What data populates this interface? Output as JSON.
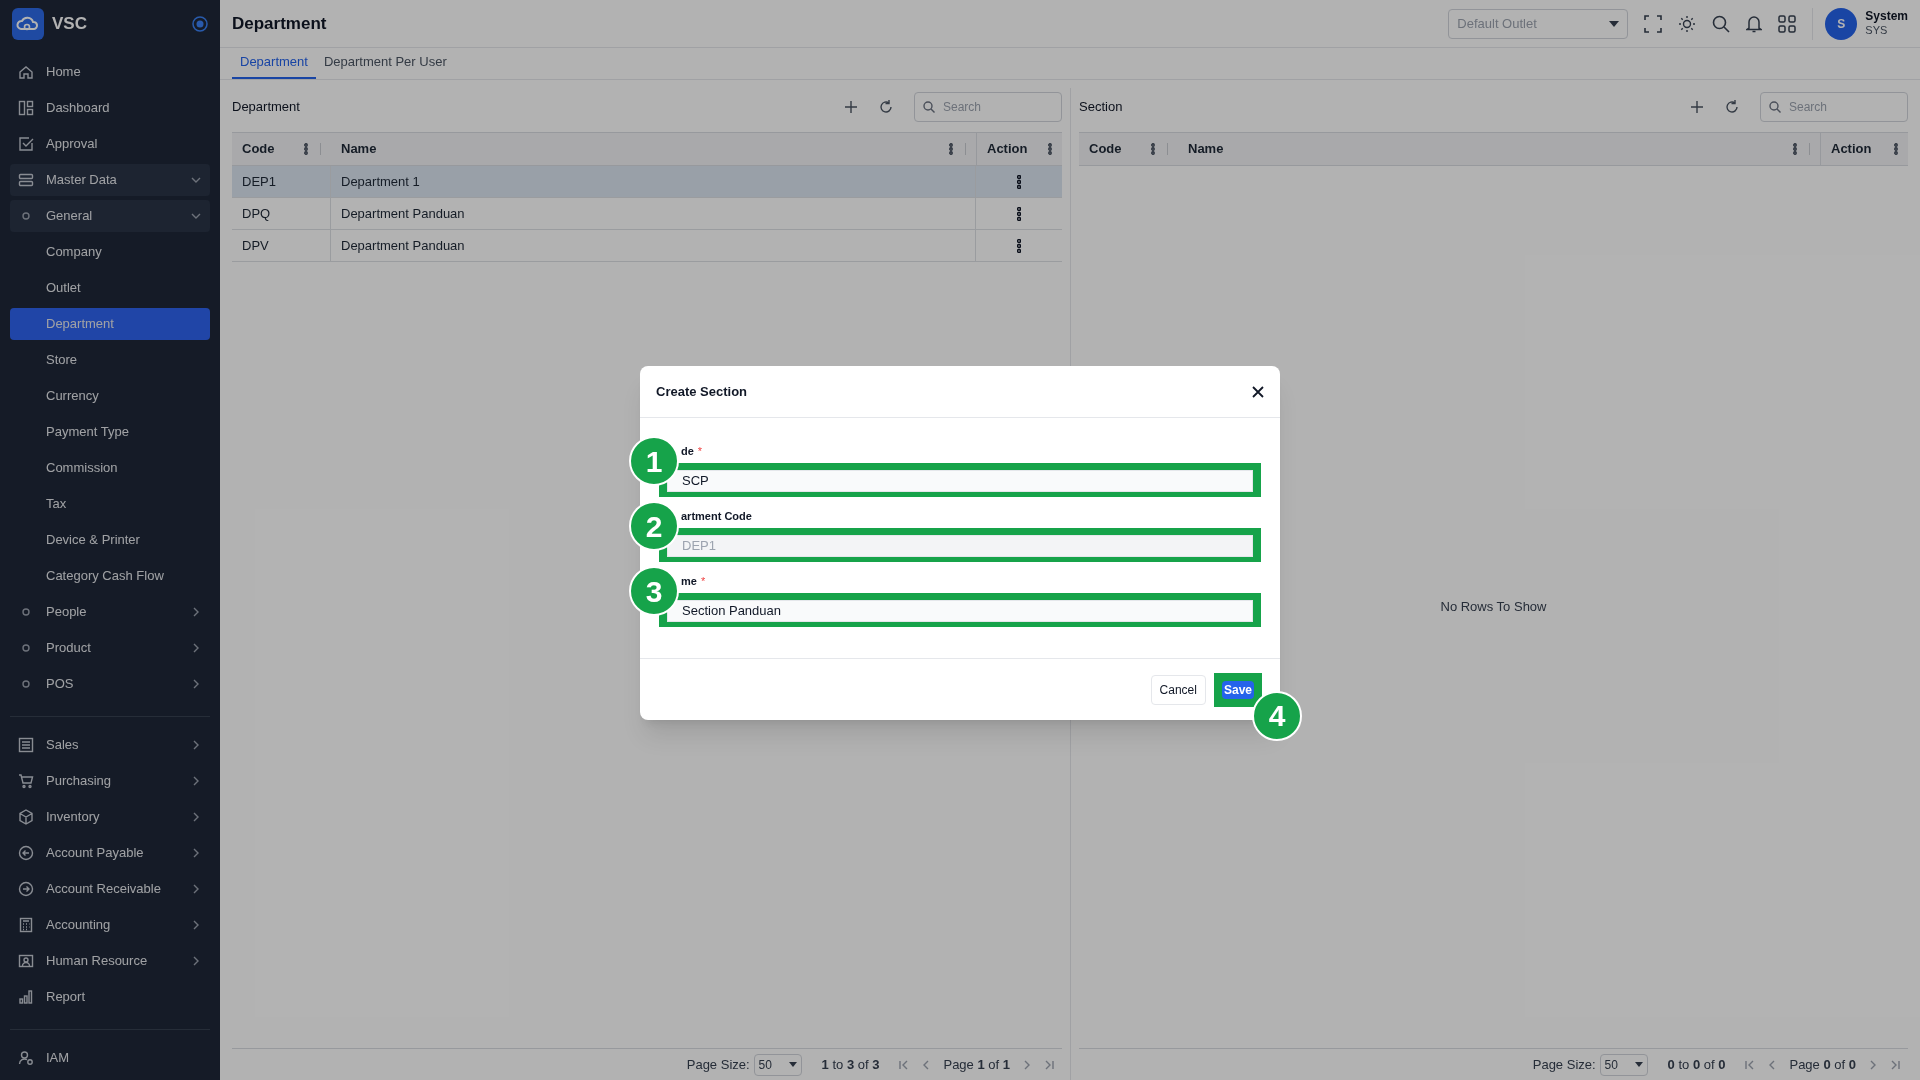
{
  "app": {
    "name": "VSC"
  },
  "sidebar": {
    "groups": [
      [
        {
          "label": "Home",
          "kind": "link",
          "selected": false
        },
        {
          "label": "Dashboard",
          "kind": "link",
          "selected": false
        },
        {
          "label": "Approval",
          "kind": "link",
          "selected": false
        },
        {
          "label": "Master Data",
          "kind": "menu",
          "selected": false,
          "expanded": true,
          "children": [
            {
              "label": "General",
              "kind": "menu",
              "selected": false,
              "expanded": true,
              "children": [
                {
                  "label": "Company",
                  "kind": "link",
                  "selected": false
                },
                {
                  "label": "Outlet",
                  "kind": "link",
                  "selected": false
                },
                {
                  "label": "Department",
                  "kind": "link",
                  "selected": true
                },
                {
                  "label": "Store",
                  "kind": "link",
                  "selected": false
                },
                {
                  "label": "Currency",
                  "kind": "link",
                  "selected": false
                },
                {
                  "label": "Payment Type",
                  "kind": "link",
                  "selected": false
                },
                {
                  "label": "Commission",
                  "kind": "link",
                  "selected": false
                },
                {
                  "label": "Tax",
                  "kind": "link",
                  "selected": false
                },
                {
                  "label": "Device & Printer",
                  "kind": "link",
                  "selected": false
                },
                {
                  "label": "Category Cash Flow",
                  "kind": "link",
                  "selected": false
                }
              ]
            },
            {
              "label": "People",
              "kind": "menu",
              "selected": false,
              "expanded": false
            },
            {
              "label": "Product",
              "kind": "menu",
              "selected": false,
              "expanded": false
            },
            {
              "label": "POS",
              "kind": "menu",
              "selected": false,
              "expanded": false
            }
          ]
        }
      ],
      [
        {
          "label": "Sales",
          "kind": "menu",
          "selected": false,
          "expanded": false
        },
        {
          "label": "Purchasing",
          "kind": "menu",
          "selected": false,
          "expanded": false
        },
        {
          "label": "Inventory",
          "kind": "menu",
          "selected": false,
          "expanded": false
        },
        {
          "label": "Account Payable",
          "kind": "menu",
          "selected": false,
          "expanded": false
        },
        {
          "label": "Account Receivable",
          "kind": "menu",
          "selected": false,
          "expanded": false
        },
        {
          "label": "Accounting",
          "kind": "menu",
          "selected": false,
          "expanded": false
        },
        {
          "label": "Human Resource",
          "kind": "menu",
          "selected": false,
          "expanded": false
        },
        {
          "label": "Report",
          "kind": "link",
          "selected": false
        }
      ],
      [
        {
          "label": "IAM",
          "kind": "link",
          "selected": false
        }
      ]
    ]
  },
  "header": {
    "title": "Department",
    "outlet_select": {
      "placeholder": "Default Outlet"
    },
    "user": {
      "initial": "S",
      "name": "System",
      "code": "SYS"
    }
  },
  "tabs": [
    {
      "label": "Department",
      "selected": true
    },
    {
      "label": "Department Per User",
      "selected": false
    }
  ],
  "panels": [
    {
      "title": "Department",
      "search": {
        "placeholder": "Search"
      },
      "table": {
        "columns": [
          "Code",
          "Name",
          "Action"
        ],
        "rows": [
          {
            "code": "DEP1",
            "name": "Department 1",
            "selected": true
          },
          {
            "code": "DPQ",
            "name": "Department Panduan",
            "selected": false
          },
          {
            "code": "DPV",
            "name": "Department Panduan",
            "selected": false
          }
        ]
      },
      "pagination": {
        "page_size_label": "Page Size:",
        "page_size": "50",
        "range": "**1** to **3** of **3**",
        "page": "Page **1** of **1**"
      }
    },
    {
      "title": "Section",
      "search": {
        "placeholder": "Search"
      },
      "table": {
        "columns": [
          "Code",
          "Name",
          "Action"
        ],
        "empty_message": "No Rows To Show"
      },
      "pagination": {
        "page_size_label": "Page Size:",
        "page_size": "50",
        "range": "**0** to **0** of **0**",
        "page": "Page **0** of **0**"
      }
    }
  ],
  "dialog": {
    "title": "Create Section",
    "fields": [
      {
        "label": "de",
        "required_mark": "*",
        "value": "SCP",
        "disabled": false,
        "highlighted": true,
        "marker": "1"
      },
      {
        "label": "artment Code",
        "value": "DEP1",
        "disabled": true,
        "highlighted": true,
        "marker": "2"
      },
      {
        "label": "me",
        "required_mark": "*",
        "value": "Section Panduan",
        "disabled": false,
        "highlighted": true,
        "marker": "3"
      }
    ],
    "buttons": [
      {
        "label": "Cancel",
        "kind": "secondary",
        "highlighted": false
      },
      {
        "label": "Save",
        "kind": "primary",
        "highlighted": true,
        "marker": "4"
      }
    ]
  }
}
